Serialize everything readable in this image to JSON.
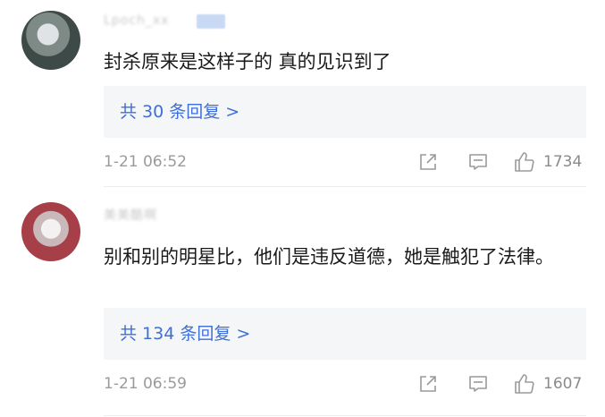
{
  "comments": [
    {
      "username": "Lpoch_xx",
      "text": "封杀原来是这样子的 真的见识到了",
      "replies_label": "共 30 条回复 >",
      "timestamp": "1-21 06:52",
      "likes": "1734"
    },
    {
      "username": "美美酷啊",
      "text": "别和别的明星比，他们是违反道德，她是触犯了法律。",
      "replies_label": "共 134 条回复 >",
      "timestamp": "1-21 06:59",
      "likes": "1607"
    }
  ],
  "icons": {
    "share": "share-icon",
    "comment": "comment-icon",
    "like": "thumbs-up-icon"
  },
  "colors": {
    "link": "#3f6fd5",
    "muted": "#9a9a9a",
    "reply_bg": "#f5f6f8"
  }
}
